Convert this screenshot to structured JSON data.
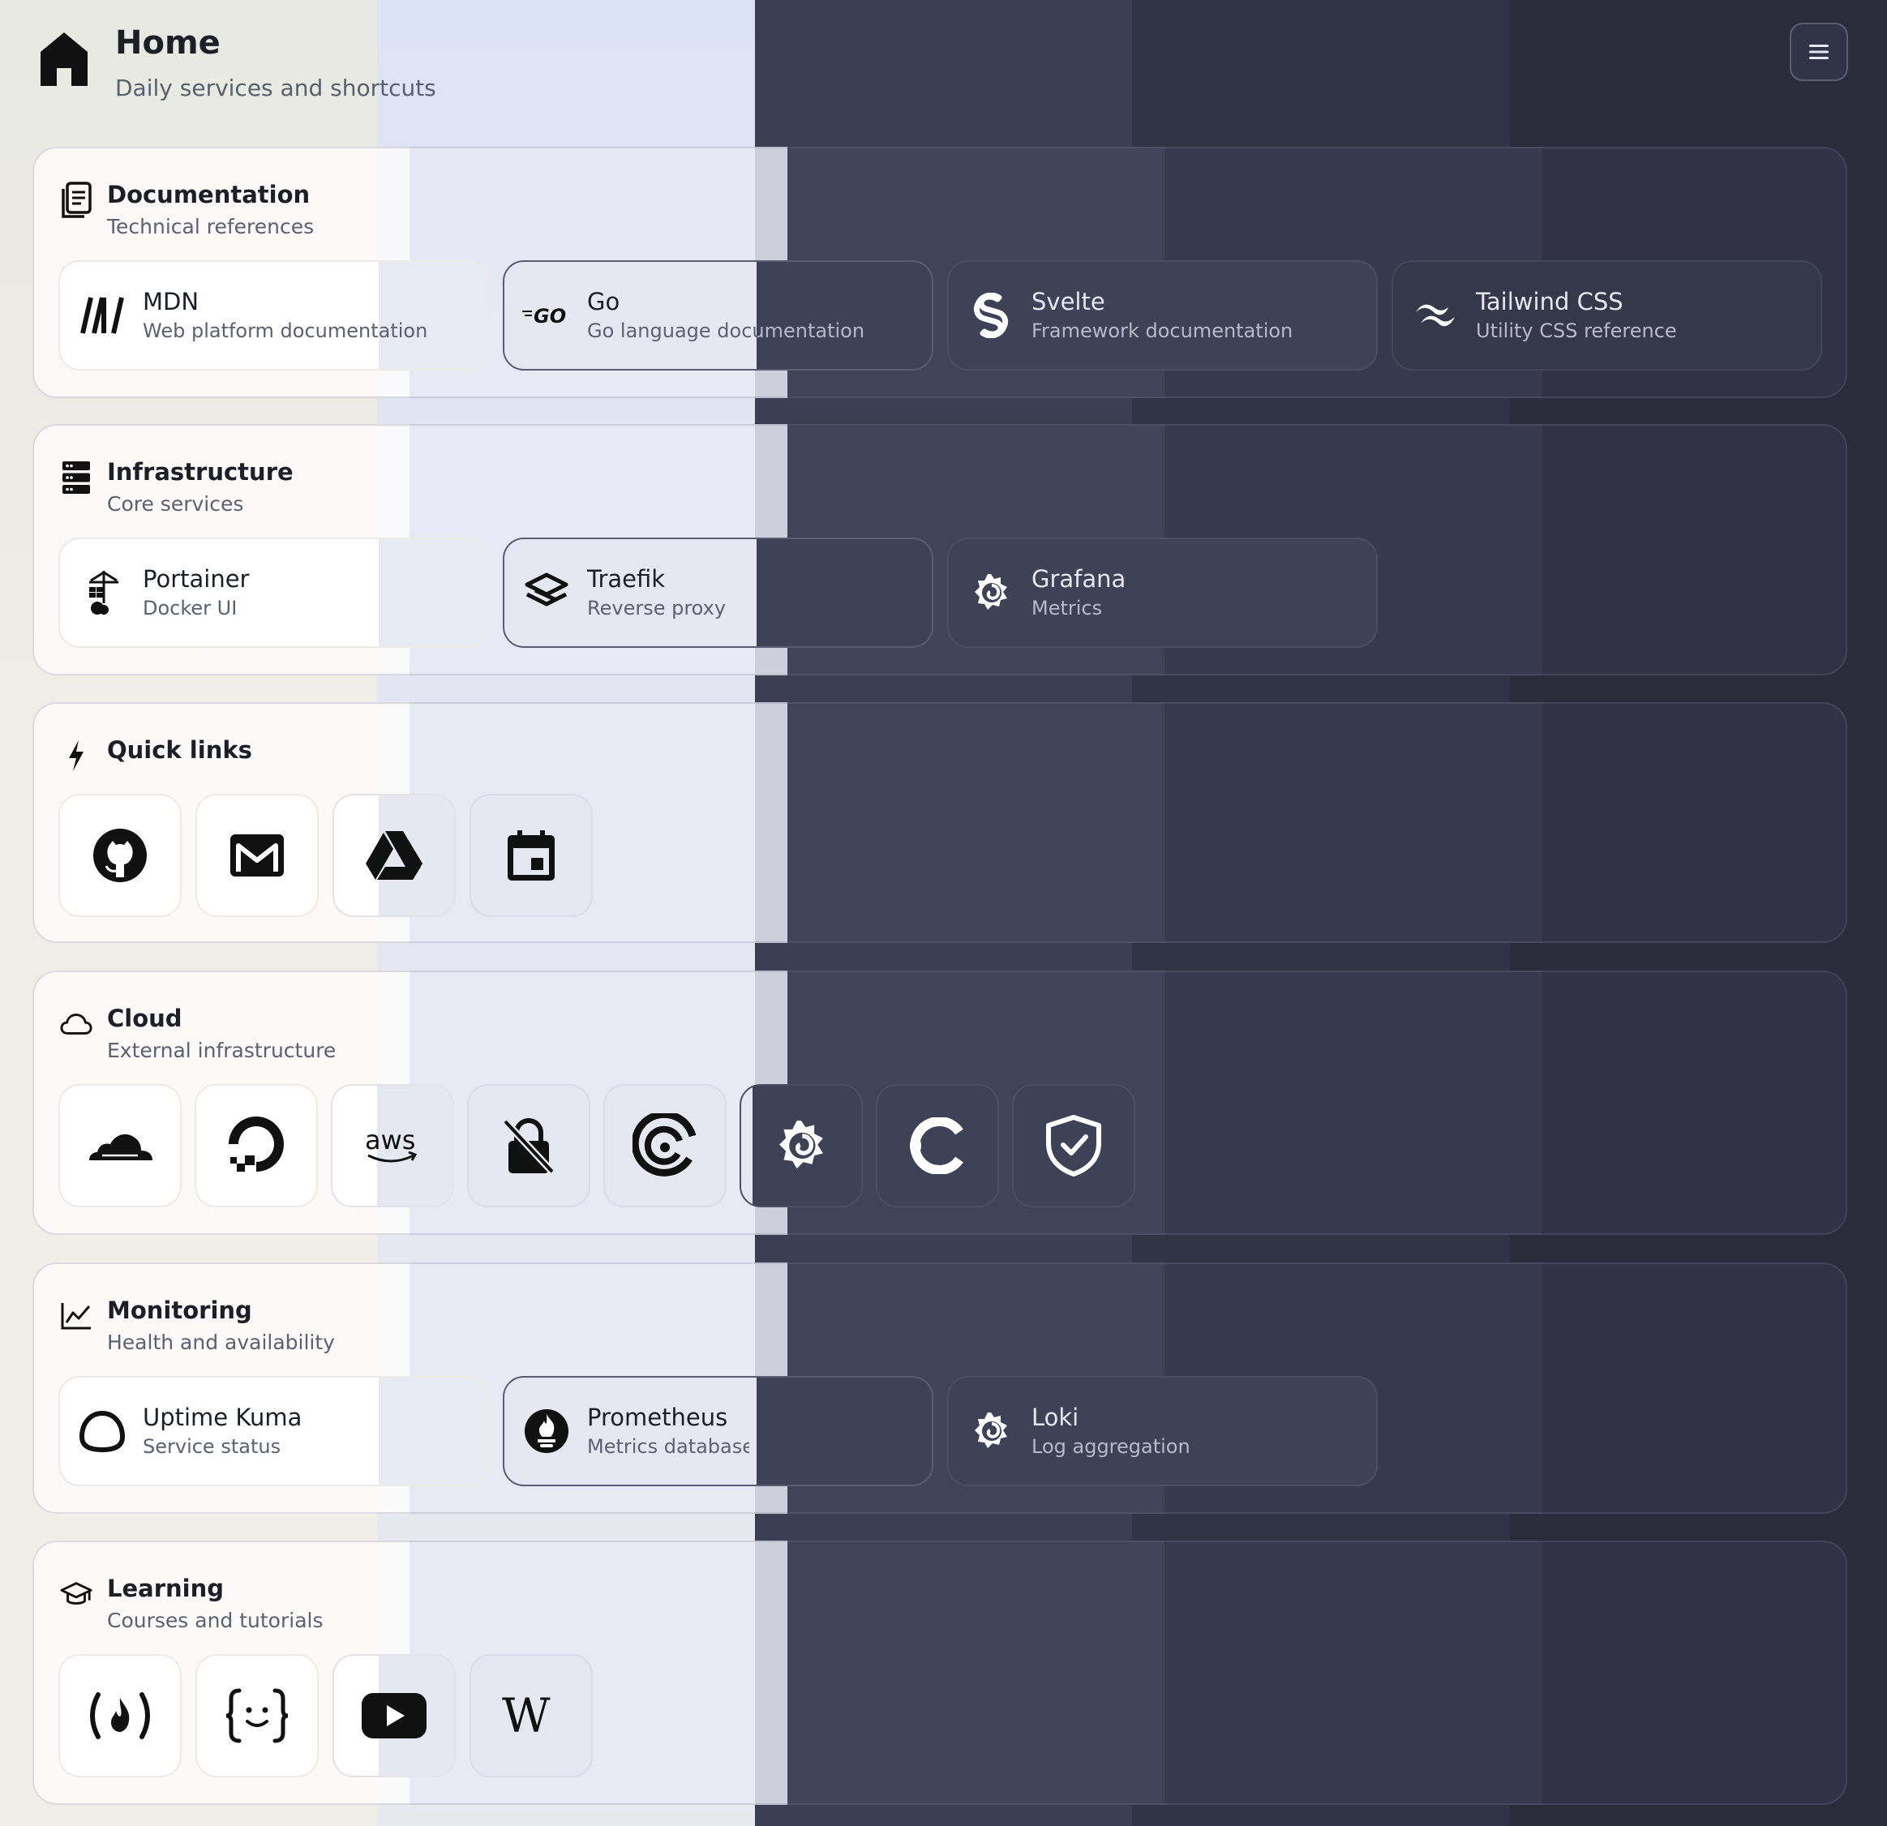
{
  "header": {
    "title": "Home",
    "subtitle": "Daily services and shortcuts",
    "menu_icon": "hamburger-menu-icon"
  },
  "sections": {
    "documentation": {
      "title": "Documentation",
      "subtitle": "Technical references",
      "icon": "document-icon",
      "items": [
        {
          "name": "MDN",
          "desc": "Web platform documentation",
          "icon": "mdn-icon"
        },
        {
          "name": "Go",
          "desc": "Go language documentation",
          "icon": "go-icon"
        },
        {
          "name": "Svelte",
          "desc": "Framework documentation",
          "icon": "svelte-icon"
        },
        {
          "name": "Tailwind CSS",
          "desc": "Utility CSS reference",
          "icon": "tailwind-icon"
        }
      ]
    },
    "infrastructure": {
      "title": "Infrastructure",
      "subtitle": "Core services",
      "icon": "server-icon",
      "items": [
        {
          "name": "Portainer",
          "desc": "Docker UI",
          "icon": "portainer-icon"
        },
        {
          "name": "Traefik",
          "desc": "Reverse proxy",
          "icon": "traefik-icon"
        },
        {
          "name": "Grafana",
          "desc": "Metrics",
          "icon": "grafana-icon"
        }
      ]
    },
    "quick_links": {
      "title": "Quick links",
      "icon": "lightning-icon",
      "items": [
        "github-icon",
        "gmail-icon",
        "google-drive-icon",
        "calendar-icon"
      ]
    },
    "cloud": {
      "title": "Cloud",
      "subtitle": "External infrastructure",
      "icon": "cloud-icon",
      "items": [
        "cloudflare-icon",
        "digitalocean-icon",
        "aws-icon",
        "lock-off-icon",
        "spiral-icon",
        "grafana-icon",
        "tailscale-icon",
        "shield-check-icon"
      ],
      "aws_text": "aws"
    },
    "monitoring": {
      "title": "Monitoring",
      "subtitle": "Health and availability",
      "icon": "chart-line-icon",
      "items": [
        {
          "name": "Uptime Kuma",
          "desc": "Service status",
          "icon": "uptime-kuma-icon"
        },
        {
          "name": "Prometheus",
          "desc": "Metrics database",
          "icon": "prometheus-icon"
        },
        {
          "name": "Loki",
          "desc": "Log aggregation",
          "icon": "loki-icon"
        }
      ]
    },
    "learning": {
      "title": "Learning",
      "subtitle": "Courses and tutorials",
      "icon": "graduation-cap-icon",
      "items": [
        "freecodecamp-icon",
        "braces-icon",
        "youtube-icon",
        "wikipedia-icon"
      ],
      "wikipedia_text": "W"
    }
  }
}
